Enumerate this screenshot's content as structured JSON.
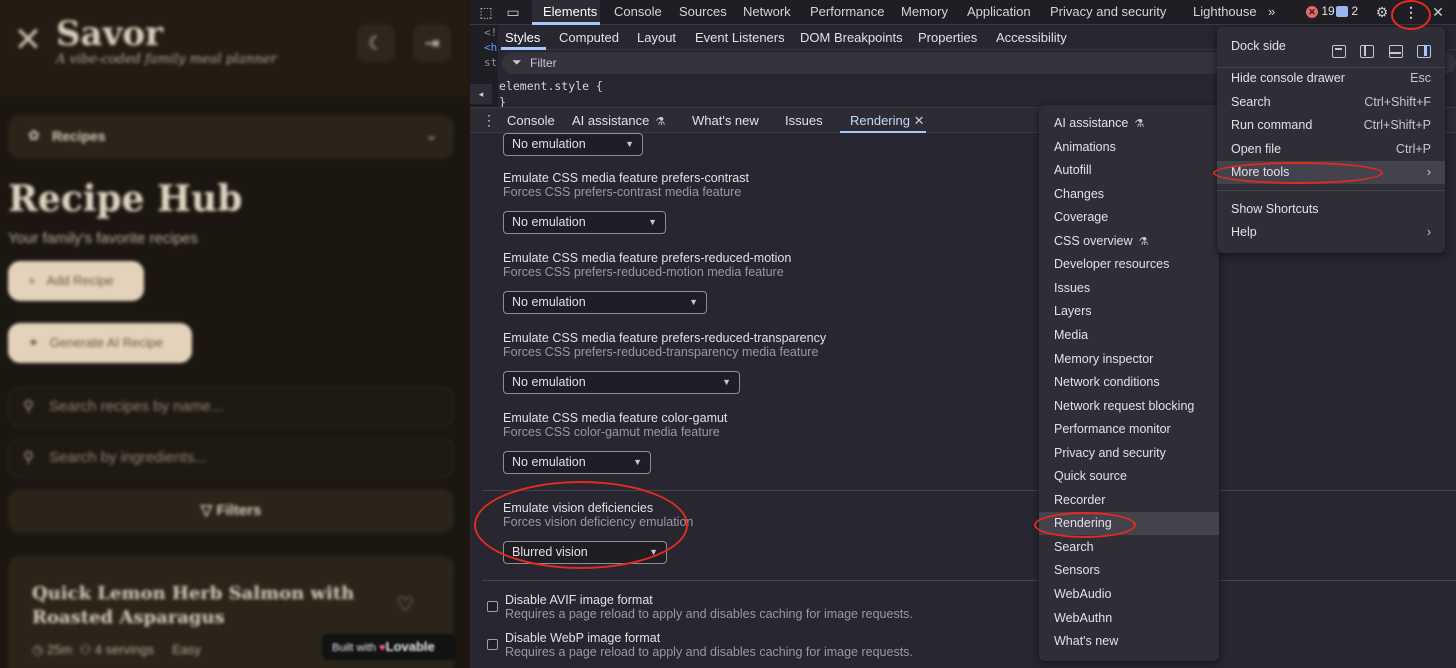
{
  "app": {
    "logo_icon": "utensils-icon",
    "title": "Savor",
    "subtitle": "A vibe-coded family meal planner",
    "theme_icon": "moon-icon",
    "logout_icon": "logout-icon",
    "section_select": "Recipes",
    "page_title": "Recipe Hub",
    "page_subtitle": "Your family's favorite recipes",
    "add_recipe": "Add Recipe",
    "generate_ai_recipe": "Generate AI Recipe",
    "search_name_placeholder": "Search recipes by name...",
    "search_ingredients_placeholder": "Search by ingredients...",
    "filters": "Filters",
    "card": {
      "title": "Quick Lemon Herb Salmon with Roasted Asparagus",
      "time": "25m",
      "servings": "4 servings",
      "difficulty": "Easy"
    },
    "badge": {
      "prefix": "Built with",
      "brand": "Lovable"
    }
  },
  "devtools": {
    "top_tabs": [
      "Elements",
      "Console",
      "Sources",
      "Network",
      "Performance",
      "Memory",
      "Application",
      "Privacy and security",
      "Lighthouse"
    ],
    "active_top_tab": "Elements",
    "errors_count": "19",
    "messages_count": "2",
    "dom_gutter": [
      "<!",
      "<h",
      "st",
      ""
    ],
    "styles_tabs": [
      "Styles",
      "Computed",
      "Layout",
      "Event Listeners",
      "DOM Breakpoints",
      "Properties",
      "Accessibility"
    ],
    "filter_placeholder": "Filter",
    "element_style": "element.style {",
    "element_style_close": "}",
    "drawer_tabs": [
      "Console",
      "AI assistance",
      "What's new",
      "Issues",
      "Rendering"
    ],
    "active_drawer_tab": "Rendering",
    "rendering": {
      "top_select": "No emulation",
      "options": [
        {
          "title": "Emulate CSS media feature prefers-contrast",
          "desc": "Forces CSS prefers-contrast media feature",
          "value": "No emulation"
        },
        {
          "title": "Emulate CSS media feature prefers-reduced-motion",
          "desc": "Forces CSS prefers-reduced-motion media feature",
          "value": "No emulation"
        },
        {
          "title": "Emulate CSS media feature prefers-reduced-transparency",
          "desc": "Forces CSS prefers-reduced-transparency media feature",
          "value": "No emulation"
        },
        {
          "title": "Emulate CSS media feature color-gamut",
          "desc": "Forces CSS color-gamut media feature",
          "value": "No emulation"
        }
      ],
      "vision": {
        "title": "Emulate vision deficiencies",
        "desc": "Forces vision deficiency emulation",
        "value": "Blurred vision"
      },
      "checkboxes": [
        {
          "title": "Disable AVIF image format",
          "desc": "Requires a page reload to apply and disables caching for image requests."
        },
        {
          "title": "Disable WebP image format",
          "desc": "Requires a page reload to apply and disables caching for image requests."
        }
      ]
    }
  },
  "main_menu": {
    "dock_side": "Dock side",
    "items_1": [
      {
        "label": "Hide console drawer",
        "shortcut": "Esc"
      },
      {
        "label": "Search",
        "shortcut": "Ctrl+Shift+F"
      },
      {
        "label": "Run command",
        "shortcut": "Ctrl+Shift+P"
      },
      {
        "label": "Open file",
        "shortcut": "Ctrl+P"
      },
      {
        "label": "More tools",
        "shortcut": "›"
      }
    ],
    "items_2": [
      {
        "label": "Show Shortcuts",
        "shortcut": ""
      },
      {
        "label": "Help",
        "shortcut": "›"
      }
    ]
  },
  "more_tools": [
    "AI assistance",
    "Animations",
    "Autofill",
    "Changes",
    "Coverage",
    "CSS overview",
    "Developer resources",
    "Issues",
    "Layers",
    "Media",
    "Memory inspector",
    "Network conditions",
    "Network request blocking",
    "Performance monitor",
    "Privacy and security",
    "Quick source",
    "Recorder",
    "Rendering",
    "Search",
    "Sensors",
    "WebAudio",
    "WebAuthn",
    "What's new"
  ],
  "more_tools_highlight": "Rendering",
  "annotation_color": "#e32b1f"
}
